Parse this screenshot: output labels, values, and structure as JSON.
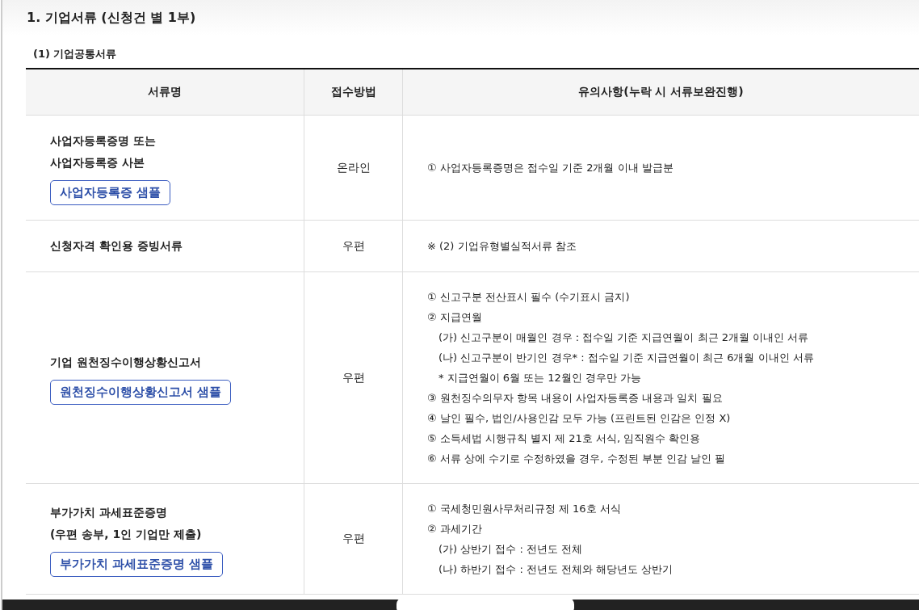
{
  "title": "1. 기업서류 (신청건 별 1부)",
  "subtitle": "(1) 기업공통서류",
  "table": {
    "columns": [
      "서류명",
      "접수방법",
      "유의사항(누락 시 서류보완진행)"
    ],
    "rows": [
      {
        "name_lines": [
          "사업자등록증명 또는",
          "사업자등록증 사본"
        ],
        "sample_button": "사업자등록증 샘플",
        "method": "온라인",
        "notes": [
          {
            "kind": "item",
            "text": "① 사업자등록증명은 접수일 기준 2개월 이내 발급분"
          }
        ]
      },
      {
        "name_lines": [
          "신청자격 확인용 증빙서류"
        ],
        "method": "우편",
        "notes": [
          {
            "kind": "item",
            "text": "※ (2) 기업유형별실적서류 참조"
          }
        ]
      },
      {
        "name_lines": [
          "기업 원천징수이행상황신고서"
        ],
        "sample_button": "원천징수이행상황신고서 샘플",
        "method": "우편",
        "notes": [
          {
            "kind": "item",
            "text": "① 신고구분 전산표시 필수 (수기표시 금지)"
          },
          {
            "kind": "item",
            "text": "② 지급연월"
          },
          {
            "kind": "sub",
            "text": "(가) 신고구분이 매월인 경우 : 접수일 기준 지급연월이 최근 2개월 이내인 서류"
          },
          {
            "kind": "sub",
            "text": "(나) 신고구분이 반기인 경우* : 접수일 기준 지급연월이 최근 6개월 이내인 서류"
          },
          {
            "kind": "sub",
            "text": "* 지급연월이 6월 또는 12월인 경우만 가능"
          },
          {
            "kind": "item",
            "text": "③ 원천징수의무자 항목 내용이 사업자등록증 내용과 일치 필요"
          },
          {
            "kind": "item",
            "text": "④ 날인 필수, 법인/사용인감 모두 가능 (프린트된 인감은 인정 X)"
          },
          {
            "kind": "item",
            "text": "⑤ 소득세법 시행규칙 별지 제 21호 서식, 임직원수 확인용"
          },
          {
            "kind": "item",
            "text": "⑥ 서류 상에 수기로 수정하였을 경우, 수정된 부분 인감 날인 필"
          }
        ]
      },
      {
        "name_lines": [
          "부가가치 과세표준증명",
          "(우편 송부, 1인 기업만 제출)"
        ],
        "sample_button": "부가가치 과세표준증명 샘플",
        "method": "우편",
        "notes": [
          {
            "kind": "item",
            "text": "① 국세청민원사무처리규정 제 16호 서식"
          },
          {
            "kind": "item",
            "text": "② 과세기간"
          },
          {
            "kind": "sub",
            "text": "(가) 상반기 접수 : 전년도 전체"
          },
          {
            "kind": "sub",
            "text": "(나) 하반기 접수 : 전년도 전체와 해당년도 상반기"
          }
        ]
      }
    ]
  }
}
